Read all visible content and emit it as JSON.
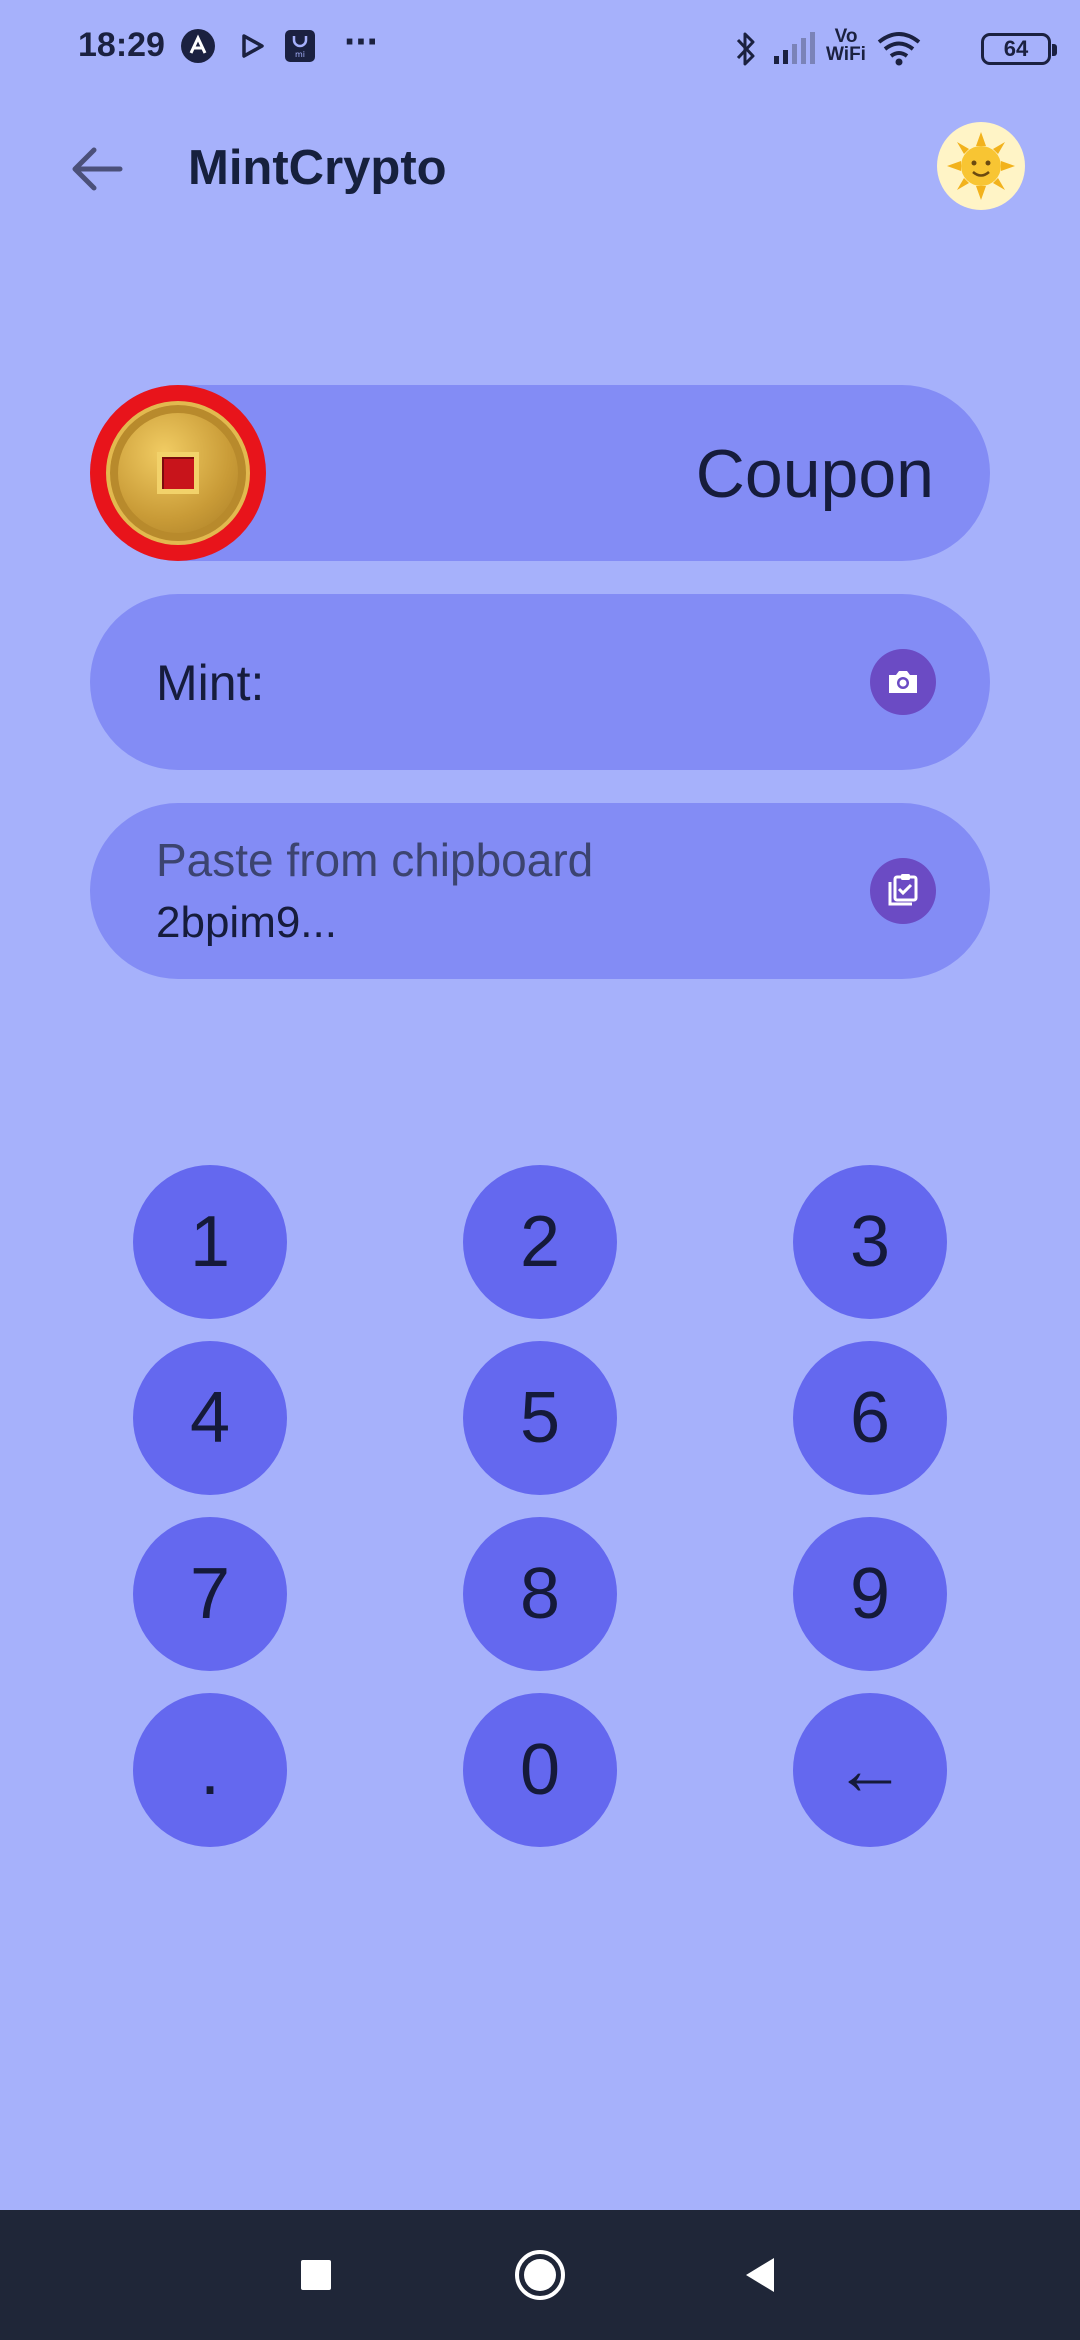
{
  "status_bar": {
    "time": "18:29",
    "battery": "64",
    "icons": [
      "arc-logo-icon",
      "play-store-icon",
      "mi-store-icon",
      "more-dots-icon",
      "bluetooth-icon",
      "signal-icon",
      "vowifi-icon",
      "wifi-icon",
      "battery-icon"
    ],
    "vowifi_top": "Vo",
    "vowifi_bottom": "WiFi",
    "more": "···"
  },
  "app_bar": {
    "title": "MintCrypto",
    "back_icon": "arrow-left-icon",
    "avatar_icon": "sun-face-icon"
  },
  "coupon": {
    "label": "Coupon",
    "icon": "gold-coin-icon"
  },
  "mint": {
    "label": "Mint:",
    "action_icon": "camera-icon"
  },
  "paste": {
    "label": "Paste from chipboard",
    "value": "2bpim9...",
    "action_icon": "clipboard-check-icon"
  },
  "keypad": {
    "keys": [
      "1",
      "2",
      "3",
      "4",
      "5",
      "6",
      "7",
      "8",
      "9",
      ".",
      "0",
      "←"
    ]
  },
  "nav_bar": {
    "icons": [
      "recents-square-icon",
      "home-circle-icon",
      "back-triangle-icon"
    ]
  },
  "colors": {
    "background": "#a6b1fb",
    "pill": "#838cf5",
    "key": "#6468ef",
    "icon_button": "#6b4bc4",
    "coin_ring": "#e8141b",
    "nav_bar": "#1f2638"
  }
}
